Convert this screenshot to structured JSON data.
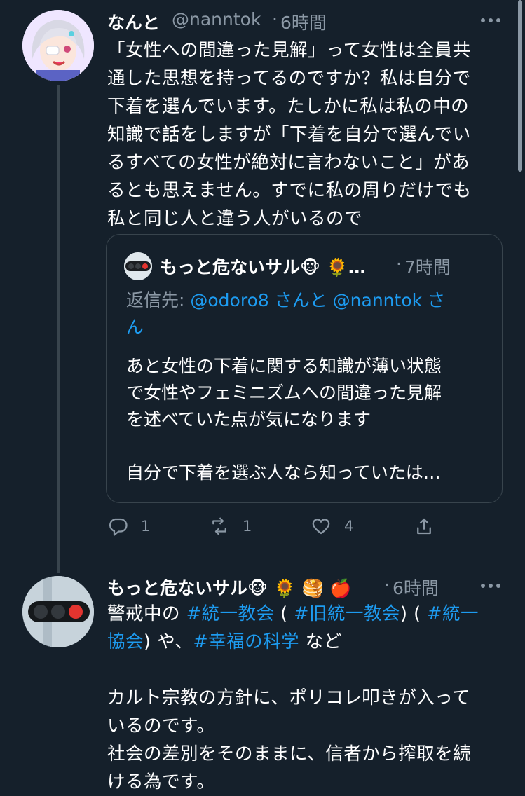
{
  "tweet1": {
    "display_name": "なんと",
    "handle": "@nanntok",
    "separator": "·",
    "time": "6時間",
    "text": "「女性への間違った見解」って女性は全員共\n通した思想を持ってるのですか？私は自分で\n下着を選んでいます。たしかに私は私の中の\n知識で話をしますが「下着を自分で選んでい\nるすべての女性が絶対に言わないこと」があ\nるとも思えません。すでに私の周りだけでも\n私と同じ人と違う人がいるので",
    "more_icon": "more-dots-icon",
    "quote": {
      "display_name": "もっと危ないサル🐵 🌻…",
      "separator": "·",
      "time": "7時間",
      "reply_prefix": "返信先: ",
      "reply_user1": "@odoro8",
      "reply_mid": " さんと ",
      "reply_user2": "@nanntok",
      "reply_suffix": " さ\nん",
      "text": "あと女性の下着に関する知識が薄い状態\nで女性やフェミニズムへの間違った見解\nを述べていた点が気になります\n\n自分で下着を選ぶ人なら知っていたは…"
    },
    "actions": {
      "reply_count": "1",
      "retweet_count": "1",
      "like_count": "4"
    }
  },
  "tweet2": {
    "display_name": "もっと危ないサル🐵 🌻 🥞 🍎",
    "separator": "·",
    "time": "6時間",
    "line1_a": "警戒中の ",
    "tag1": "#統一教会",
    "line1_b": " ( ",
    "tag2": "#旧統一教会",
    "line1_c": ") ( ",
    "tag3a": "#統一",
    "tag3b": "協会",
    "line2_a": ") や、",
    "tag4": "#幸福の科学",
    "line2_b": " など",
    "text_rest": "カルト宗教の方針に、ポリコレ叩きが入って\nいるのです。\n社会の差別をそのままに、信者から搾取を続\nける為です。"
  },
  "colors": {
    "background": "#15202b",
    "link": "#1d9bf0",
    "muted": "#8b98a5",
    "border": "#38444d"
  }
}
